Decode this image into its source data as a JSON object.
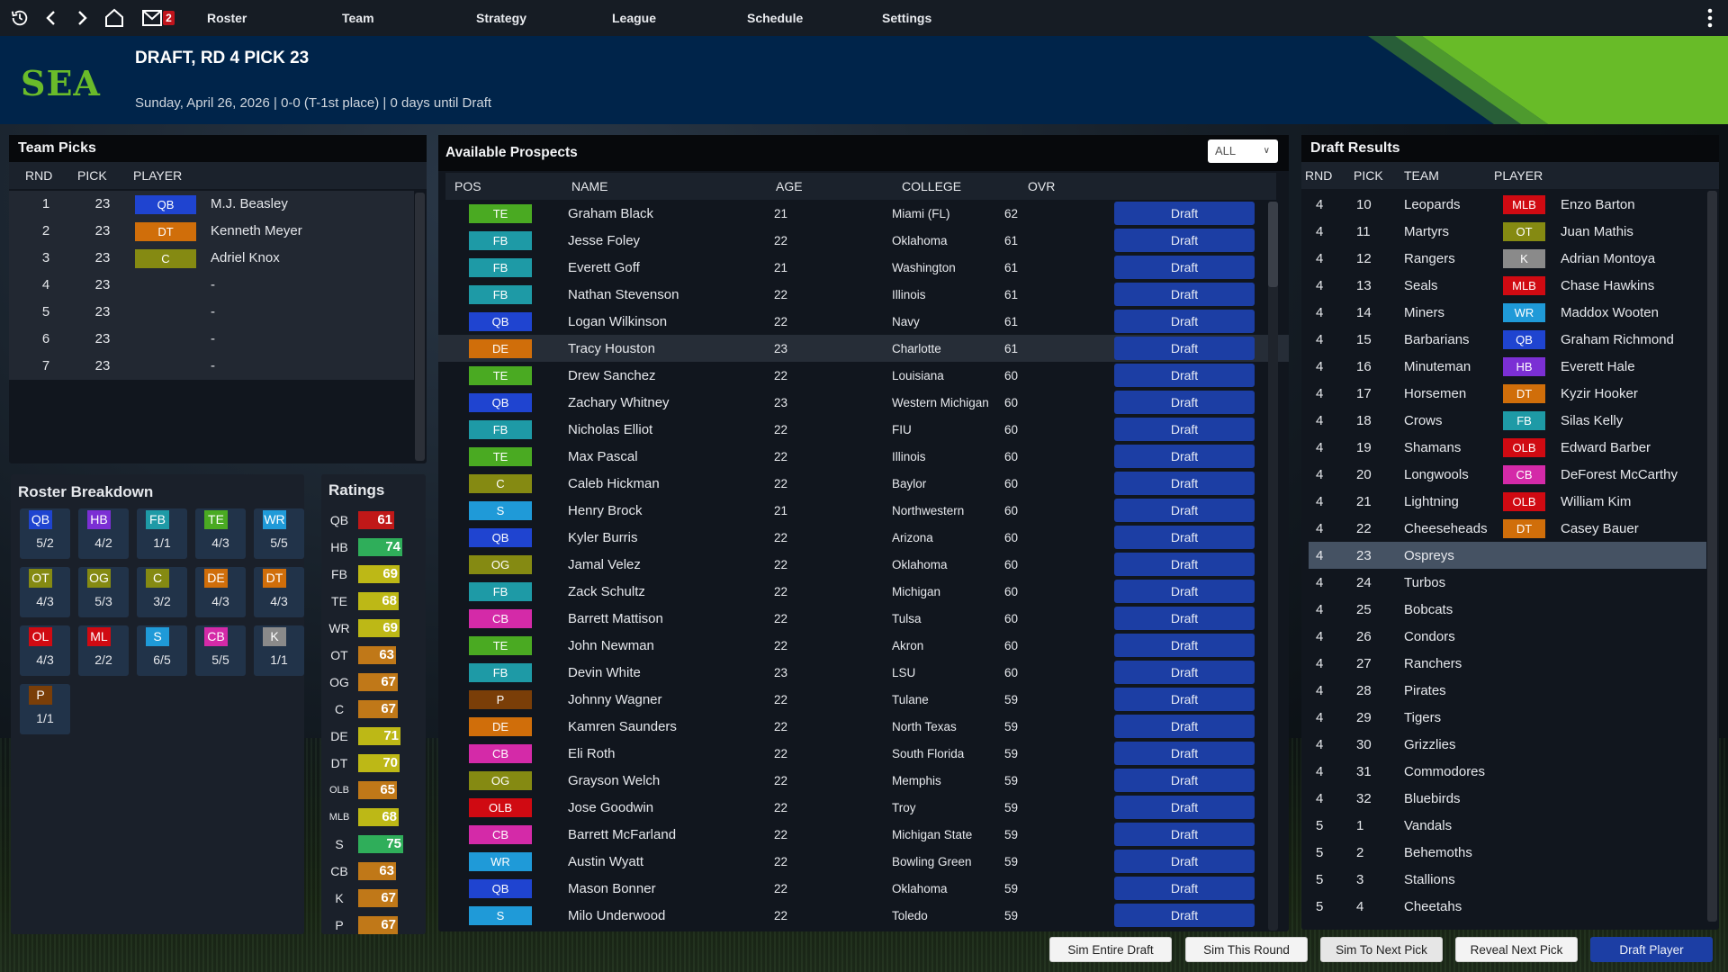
{
  "nav": {
    "mail_count": "2",
    "links": [
      "Roster",
      "Team",
      "Strategy",
      "League",
      "Schedule",
      "Settings"
    ]
  },
  "banner": {
    "team_abbr": "SEA",
    "title": "DRAFT, RD 4 PICK 23",
    "subtitle": "Sunday, April 26, 2026 | 0-0 (T-1st place) | 0 days until Draft",
    "colors": {
      "primary": "#00244a",
      "accent": "#6abb2a"
    }
  },
  "position_colors": {
    "QB": "#1f44d0",
    "HB": "#7b2fd4",
    "FB": "#1e9aa6",
    "TE": "#4aaa22",
    "WR": "#1f9ad8",
    "OT": "#858a12",
    "OG": "#858a12",
    "C": "#858a12",
    "DE": "#d06e0a",
    "DT": "#d06e0a",
    "OL": "#d00a12",
    "OLB": "#d00a12",
    "ML": "#d00a12",
    "MLB": "#d00a12",
    "S": "#1f9ad8",
    "CB": "#d42aa8",
    "K": "#8a8a8a",
    "P": "#7a3e08"
  },
  "team_picks": {
    "title": "Team Picks",
    "headers": [
      "RND",
      "PICK",
      "PLAYER"
    ],
    "rows": [
      {
        "rnd": "1",
        "pick": "23",
        "pos": "QB",
        "player": "M.J. Beasley"
      },
      {
        "rnd": "2",
        "pick": "23",
        "pos": "DT",
        "player": "Kenneth Meyer"
      },
      {
        "rnd": "3",
        "pick": "23",
        "pos": "C",
        "player": "Adriel Knox"
      },
      {
        "rnd": "4",
        "pick": "23",
        "pos": "",
        "player": "-"
      },
      {
        "rnd": "5",
        "pick": "23",
        "pos": "",
        "player": "-"
      },
      {
        "rnd": "6",
        "pick": "23",
        "pos": "",
        "player": "-"
      },
      {
        "rnd": "7",
        "pick": "23",
        "pos": "",
        "player": "-"
      }
    ]
  },
  "roster_breakdown": {
    "title": "Roster Breakdown",
    "items": [
      {
        "pos": "QB",
        "value": "5/2"
      },
      {
        "pos": "HB",
        "value": "4/2"
      },
      {
        "pos": "FB",
        "value": "1/1"
      },
      {
        "pos": "TE",
        "value": "4/3"
      },
      {
        "pos": "WR",
        "value": "5/5"
      },
      {
        "pos": "OT",
        "value": "4/3"
      },
      {
        "pos": "OG",
        "value": "5/3"
      },
      {
        "pos": "C",
        "value": "3/2"
      },
      {
        "pos": "DE",
        "value": "4/3"
      },
      {
        "pos": "DT",
        "value": "4/3"
      },
      {
        "pos": "OL",
        "value": "4/3"
      },
      {
        "pos": "ML",
        "value": "2/2"
      },
      {
        "pos": "S",
        "value": "6/5"
      },
      {
        "pos": "CB",
        "value": "5/5"
      },
      {
        "pos": "K",
        "value": "1/1"
      },
      {
        "pos": "P",
        "value": "1/1"
      }
    ]
  },
  "ratings": {
    "title": "Ratings",
    "items": [
      {
        "pos": "QB",
        "value": 61,
        "color": "#c01818"
      },
      {
        "pos": "HB",
        "value": 74,
        "color": "#2fae5a"
      },
      {
        "pos": "FB",
        "value": 69,
        "color": "#bdb816"
      },
      {
        "pos": "TE",
        "value": 68,
        "color": "#bdb816"
      },
      {
        "pos": "WR",
        "value": 69,
        "color": "#bdb816"
      },
      {
        "pos": "OT",
        "value": 63,
        "color": "#c07818"
      },
      {
        "pos": "OG",
        "value": 67,
        "color": "#c07818"
      },
      {
        "pos": "C",
        "value": 67,
        "color": "#c07818"
      },
      {
        "pos": "DE",
        "value": 71,
        "color": "#bdb816"
      },
      {
        "pos": "DT",
        "value": 70,
        "color": "#bdb816"
      },
      {
        "pos": "OLB",
        "value": 65,
        "color": "#c07818"
      },
      {
        "pos": "MLB",
        "value": 68,
        "color": "#bdb816"
      },
      {
        "pos": "S",
        "value": 75,
        "color": "#2fae5a"
      },
      {
        "pos": "CB",
        "value": 63,
        "color": "#c07818"
      },
      {
        "pos": "K",
        "value": 67,
        "color": "#c07818"
      },
      {
        "pos": "P",
        "value": 67,
        "color": "#c07818"
      }
    ]
  },
  "prospects": {
    "title": "Available Prospects",
    "filter_value": "ALL",
    "headers": [
      "POS",
      "NAME",
      "AGE",
      "COLLEGE",
      "OVR"
    ],
    "draft_label": "Draft",
    "selected_index": 5,
    "rows": [
      {
        "pos": "TE",
        "name": "Graham Black",
        "age": "21",
        "college": "Miami (FL)",
        "ovr": "62"
      },
      {
        "pos": "FB",
        "name": "Jesse Foley",
        "age": "22",
        "college": "Oklahoma",
        "ovr": "61"
      },
      {
        "pos": "FB",
        "name": "Everett Goff",
        "age": "21",
        "college": "Washington",
        "ovr": "61"
      },
      {
        "pos": "FB",
        "name": "Nathan Stevenson",
        "age": "22",
        "college": "Illinois",
        "ovr": "61"
      },
      {
        "pos": "QB",
        "name": "Logan Wilkinson",
        "age": "22",
        "college": "Navy",
        "ovr": "61"
      },
      {
        "pos": "DE",
        "name": "Tracy Houston",
        "age": "23",
        "college": "Charlotte",
        "ovr": "61"
      },
      {
        "pos": "TE",
        "name": "Drew Sanchez",
        "age": "22",
        "college": "Louisiana",
        "ovr": "60"
      },
      {
        "pos": "QB",
        "name": "Zachary Whitney",
        "age": "23",
        "college": "Western Michigan",
        "ovr": "60"
      },
      {
        "pos": "FB",
        "name": "Nicholas Elliot",
        "age": "22",
        "college": "FIU",
        "ovr": "60"
      },
      {
        "pos": "TE",
        "name": "Max Pascal",
        "age": "22",
        "college": "Illinois",
        "ovr": "60"
      },
      {
        "pos": "C",
        "name": "Caleb Hickman",
        "age": "22",
        "college": "Baylor",
        "ovr": "60"
      },
      {
        "pos": "S",
        "name": "Henry Brock",
        "age": "21",
        "college": "Northwestern",
        "ovr": "60"
      },
      {
        "pos": "QB",
        "name": "Kyler Burris",
        "age": "22",
        "college": "Arizona",
        "ovr": "60"
      },
      {
        "pos": "OG",
        "name": "Jamal Velez",
        "age": "22",
        "college": "Oklahoma",
        "ovr": "60"
      },
      {
        "pos": "FB",
        "name": "Zack Schultz",
        "age": "22",
        "college": "Michigan",
        "ovr": "60"
      },
      {
        "pos": "CB",
        "name": "Barrett Mattison",
        "age": "22",
        "college": "Tulsa",
        "ovr": "60"
      },
      {
        "pos": "TE",
        "name": "John Newman",
        "age": "22",
        "college": "Akron",
        "ovr": "60"
      },
      {
        "pos": "FB",
        "name": "Devin White",
        "age": "23",
        "college": "LSU",
        "ovr": "60"
      },
      {
        "pos": "P",
        "name": "Johnny Wagner",
        "age": "22",
        "college": "Tulane",
        "ovr": "59"
      },
      {
        "pos": "DE",
        "name": "Kamren Saunders",
        "age": "22",
        "college": "North Texas",
        "ovr": "59"
      },
      {
        "pos": "CB",
        "name": "Eli Roth",
        "age": "22",
        "college": "South Florida",
        "ovr": "59"
      },
      {
        "pos": "OG",
        "name": "Grayson Welch",
        "age": "22",
        "college": "Memphis",
        "ovr": "59"
      },
      {
        "pos": "OLB",
        "name": "Jose Goodwin",
        "age": "22",
        "college": "Troy",
        "ovr": "59"
      },
      {
        "pos": "CB",
        "name": "Barrett McFarland",
        "age": "22",
        "college": "Michigan State",
        "ovr": "59"
      },
      {
        "pos": "WR",
        "name": "Austin Wyatt",
        "age": "22",
        "college": "Bowling Green",
        "ovr": "59"
      },
      {
        "pos": "QB",
        "name": "Mason Bonner",
        "age": "22",
        "college": "Oklahoma",
        "ovr": "59"
      },
      {
        "pos": "S",
        "name": "Milo Underwood",
        "age": "22",
        "college": "Toledo",
        "ovr": "59"
      }
    ]
  },
  "draft_results": {
    "title": "Draft Results",
    "headers": [
      "RND",
      "PICK",
      "TEAM",
      "PLAYER"
    ],
    "selected_index": 13,
    "rows": [
      {
        "rnd": "4",
        "pick": "10",
        "team": "Leopards",
        "pos": "MLB",
        "player": "Enzo Barton"
      },
      {
        "rnd": "4",
        "pick": "11",
        "team": "Martyrs",
        "pos": "OT",
        "player": "Juan Mathis"
      },
      {
        "rnd": "4",
        "pick": "12",
        "team": "Rangers",
        "pos": "K",
        "player": "Adrian Montoya"
      },
      {
        "rnd": "4",
        "pick": "13",
        "team": "Seals",
        "pos": "MLB",
        "player": "Chase Hawkins"
      },
      {
        "rnd": "4",
        "pick": "14",
        "team": "Miners",
        "pos": "WR",
        "player": "Maddox Wooten"
      },
      {
        "rnd": "4",
        "pick": "15",
        "team": "Barbarians",
        "pos": "QB",
        "player": "Graham Richmond"
      },
      {
        "rnd": "4",
        "pick": "16",
        "team": "Minuteman",
        "pos": "HB",
        "player": "Everett Hale"
      },
      {
        "rnd": "4",
        "pick": "17",
        "team": "Horsemen",
        "pos": "DT",
        "player": "Kyzir Hooker"
      },
      {
        "rnd": "4",
        "pick": "18",
        "team": "Crows",
        "pos": "FB",
        "player": "Silas Kelly"
      },
      {
        "rnd": "4",
        "pick": "19",
        "team": "Shamans",
        "pos": "OLB",
        "player": "Edward Barber"
      },
      {
        "rnd": "4",
        "pick": "20",
        "team": "Longwools",
        "pos": "CB",
        "player": "DeForest McCarthy"
      },
      {
        "rnd": "4",
        "pick": "21",
        "team": "Lightning",
        "pos": "OLB",
        "player": "William Kim"
      },
      {
        "rnd": "4",
        "pick": "22",
        "team": "Cheeseheads",
        "pos": "DT",
        "player": "Casey Bauer"
      },
      {
        "rnd": "4",
        "pick": "23",
        "team": "Ospreys",
        "pos": "",
        "player": ""
      },
      {
        "rnd": "4",
        "pick": "24",
        "team": "Turbos",
        "pos": "",
        "player": ""
      },
      {
        "rnd": "4",
        "pick": "25",
        "team": "Bobcats",
        "pos": "",
        "player": ""
      },
      {
        "rnd": "4",
        "pick": "26",
        "team": "Condors",
        "pos": "",
        "player": ""
      },
      {
        "rnd": "4",
        "pick": "27",
        "team": "Ranchers",
        "pos": "",
        "player": ""
      },
      {
        "rnd": "4",
        "pick": "28",
        "team": "Pirates",
        "pos": "",
        "player": ""
      },
      {
        "rnd": "4",
        "pick": "29",
        "team": "Tigers",
        "pos": "",
        "player": ""
      },
      {
        "rnd": "4",
        "pick": "30",
        "team": "Grizzlies",
        "pos": "",
        "player": ""
      },
      {
        "rnd": "4",
        "pick": "31",
        "team": "Commodores",
        "pos": "",
        "player": ""
      },
      {
        "rnd": "4",
        "pick": "32",
        "team": "Bluebirds",
        "pos": "",
        "player": ""
      },
      {
        "rnd": "5",
        "pick": "1",
        "team": "Vandals",
        "pos": "",
        "player": ""
      },
      {
        "rnd": "5",
        "pick": "2",
        "team": "Behemoths",
        "pos": "",
        "player": ""
      },
      {
        "rnd": "5",
        "pick": "3",
        "team": "Stallions",
        "pos": "",
        "player": ""
      },
      {
        "rnd": "5",
        "pick": "4",
        "team": "Cheetahs",
        "pos": "",
        "player": ""
      }
    ]
  },
  "actions": {
    "sim_entire_draft": "Sim Entire Draft",
    "sim_this_round": "Sim This Round",
    "sim_to_next_pick": "Sim To Next Pick",
    "reveal_next_pick": "Reveal Next Pick",
    "draft_player": "Draft Player"
  }
}
